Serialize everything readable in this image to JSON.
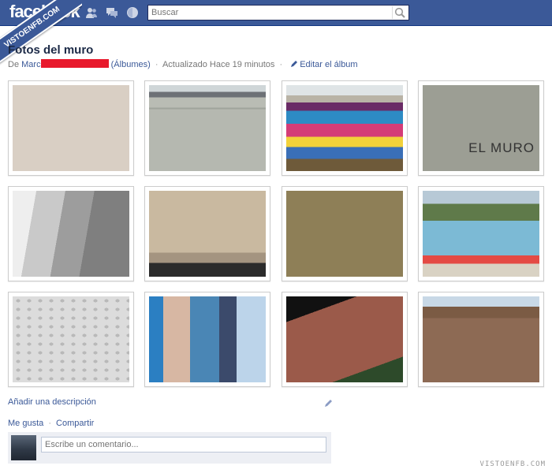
{
  "watermark": {
    "stamp": "VISTOENFB.COM",
    "footer": "VISTOENFB.COM"
  },
  "topbar": {
    "logo": "facebook",
    "jewels": [
      "friend-requests-icon",
      "messages-icon",
      "notifications-icon"
    ],
    "search": {
      "placeholder": "Buscar",
      "value": ""
    }
  },
  "album": {
    "title": "Fotos del muro",
    "owner_prefix": "De ",
    "owner_visible": "Marc",
    "albums_link": "(Álbumes)",
    "updated": "Actualizado Hace 19 minutos",
    "edit_label": "Editar el álbum",
    "photos": [
      {
        "name": "photo-brick-wall-red"
      },
      {
        "name": "photo-concrete-wall"
      },
      {
        "name": "photo-berlin-wall-graffiti"
      },
      {
        "name": "photo-block-wall-el-muro"
      },
      {
        "name": "photo-stone-wall-perspective"
      },
      {
        "name": "photo-western-wall"
      },
      {
        "name": "photo-yellow-brick-wall"
      },
      {
        "name": "photo-graffiti-monsters-wall"
      },
      {
        "name": "photo-white-stone-wall"
      },
      {
        "name": "photo-east-side-gallery"
      },
      {
        "name": "photo-brick-wall-night"
      },
      {
        "name": "photo-tuff-stone-wall"
      }
    ],
    "photo_texts": {
      "el_muro": "EL MURO"
    }
  },
  "below": {
    "add_description": "Añadir una descripción"
  },
  "actions": {
    "like": "Me gusta",
    "share": "Compartir"
  },
  "comment": {
    "placeholder": "Escribe un comentario..."
  },
  "colors": {
    "brand": "#3b5998",
    "redaction": "#e8192c"
  }
}
